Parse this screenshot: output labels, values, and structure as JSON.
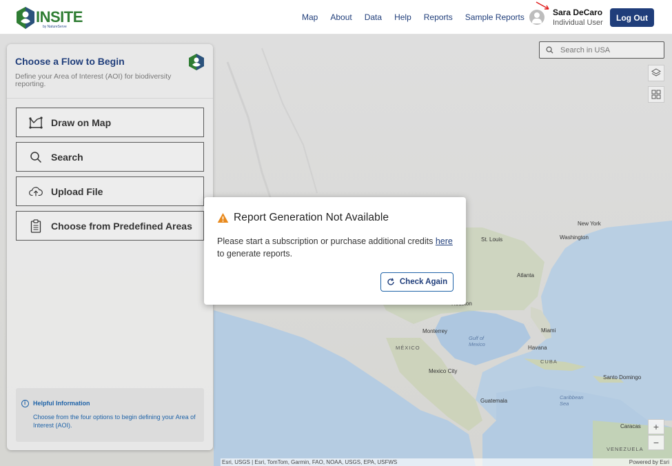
{
  "brand": {
    "name": "INSITE",
    "tagline": "by NatureServe",
    "green": "#2f7d33",
    "navy": "#1f3d7a"
  },
  "nav": {
    "items": [
      "Map",
      "About",
      "Data",
      "Help",
      "Reports",
      "Sample Reports"
    ]
  },
  "user": {
    "name": "Sara DeCaro",
    "role": "Individual User",
    "logout_label": "Log Out"
  },
  "map": {
    "search_placeholder": "Search in USA",
    "labels": {
      "new_york": "New York",
      "washington": "Washington",
      "st_louis": "St. Louis",
      "atlanta": "Atlanta",
      "houston": "Houston",
      "miami": "Miami",
      "havana": "Havana",
      "cuba": "CUBA",
      "monterrey": "Monterrey",
      "mexico": "MÉXICO",
      "gulf": "Gulf of Mexico",
      "mexico_city": "Mexico City",
      "guatemala": "Guatemala",
      "santo_domingo": "Santo Domingo",
      "caribbean": "Caribbean Sea",
      "caracas": "Caracas",
      "venezuela": "VENEZUELA"
    },
    "attribution": "Esri, USGS | Esri, TomTom, Garmin, FAO, NOAA, USGS, EPA, USFWS",
    "powered_by": "Powered by Esri",
    "zoom_in": "+",
    "zoom_out": "−"
  },
  "panel": {
    "title": "Choose a Flow to Begin",
    "subtitle": "Define your Area of Interest (AOI) for biodiversity reporting.",
    "options": [
      {
        "label": "Draw on Map",
        "icon": "draw-map-icon"
      },
      {
        "label": "Search",
        "icon": "search-icon"
      },
      {
        "label": "Upload File",
        "icon": "upload-cloud-icon"
      },
      {
        "label": "Choose from Predefined Areas",
        "icon": "clipboard-icon"
      }
    ],
    "help": {
      "title": "Helpful Information",
      "text": "Choose from the four options to begin defining your Area of Interest (AOI)."
    }
  },
  "modal": {
    "title": "Report Generation Not Available",
    "body_before": "Please start a subscription or purchase additional credits ",
    "link_text": "here",
    "body_after": " to generate reports.",
    "button_label": "Check Again",
    "warning_color": "#e8891c"
  }
}
